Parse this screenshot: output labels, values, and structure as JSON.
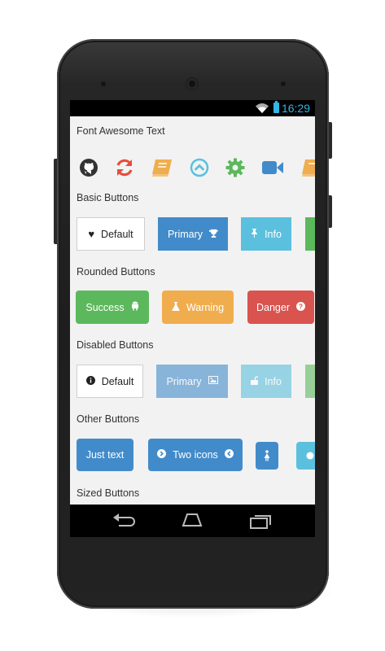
{
  "status": {
    "time": "16:29",
    "accent": "#33b5e5"
  },
  "sections": {
    "font_awesome": "Font Awesome Text",
    "basic": "Basic Buttons",
    "rounded": "Rounded Buttons",
    "disabled": "Disabled Buttons",
    "other": "Other Buttons",
    "sized": "Sized Buttons"
  },
  "icons": [
    {
      "name": "github-icon",
      "color": "#333333"
    },
    {
      "name": "refresh-icon",
      "color": "#e74c3c"
    },
    {
      "name": "book-icon",
      "color": "#f0ad4e"
    },
    {
      "name": "chevron-circle-up-icon",
      "color": "#5bc0de"
    },
    {
      "name": "gear-icon",
      "color": "#5cb85c"
    },
    {
      "name": "video-camera-icon",
      "color": "#428bca"
    },
    {
      "name": "book-icon",
      "color": "#f0ad4e"
    }
  ],
  "basic_buttons": {
    "default": "Default",
    "primary": "Primary",
    "info": "Info"
  },
  "rounded_buttons": {
    "success": "Success",
    "warning": "Warning",
    "danger": "Danger"
  },
  "disabled_buttons": {
    "default": "Default",
    "primary": "Primary",
    "info": "Info"
  },
  "other_buttons": {
    "just_text": "Just text",
    "two_icons": "Two icons"
  },
  "colors": {
    "primary": "#428bca",
    "info": "#5bc0de",
    "success": "#5cb85c",
    "warning": "#f0ad4e",
    "danger": "#d9534f"
  }
}
